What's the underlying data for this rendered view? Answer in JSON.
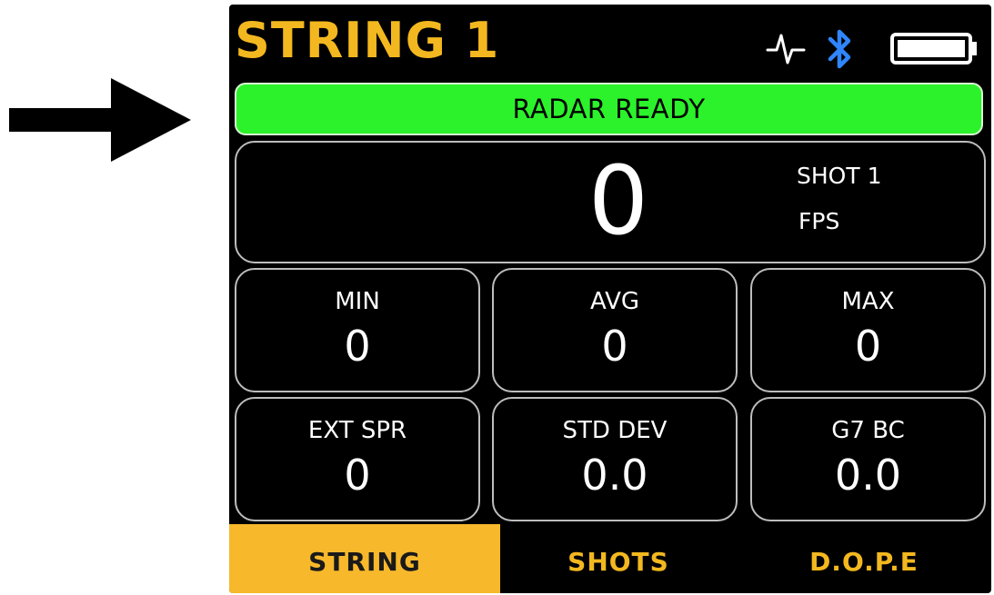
{
  "header": {
    "title": "STRING 1",
    "icons": [
      "activity-icon",
      "bluetooth-icon",
      "battery-icon"
    ]
  },
  "status": {
    "text": "RADAR READY",
    "color": "#2bf22b"
  },
  "shot": {
    "value": "0",
    "label": "SHOT 1",
    "unit": "FPS"
  },
  "stats": [
    {
      "label": "MIN",
      "value": "0"
    },
    {
      "label": "AVG",
      "value": "0"
    },
    {
      "label": "MAX",
      "value": "0"
    },
    {
      "label": "EXT SPR",
      "value": "0"
    },
    {
      "label": "STD DEV",
      "value": "0.0"
    },
    {
      "label": "G7 BC",
      "value": "0.0"
    }
  ],
  "tabs": [
    {
      "label": "STRING",
      "active": true
    },
    {
      "label": "SHOTS",
      "active": false
    },
    {
      "label": "D.O.P.E",
      "active": false
    }
  ],
  "colors": {
    "accent": "#f3b81f",
    "background": "#000000",
    "ready": "#2bf22b"
  }
}
